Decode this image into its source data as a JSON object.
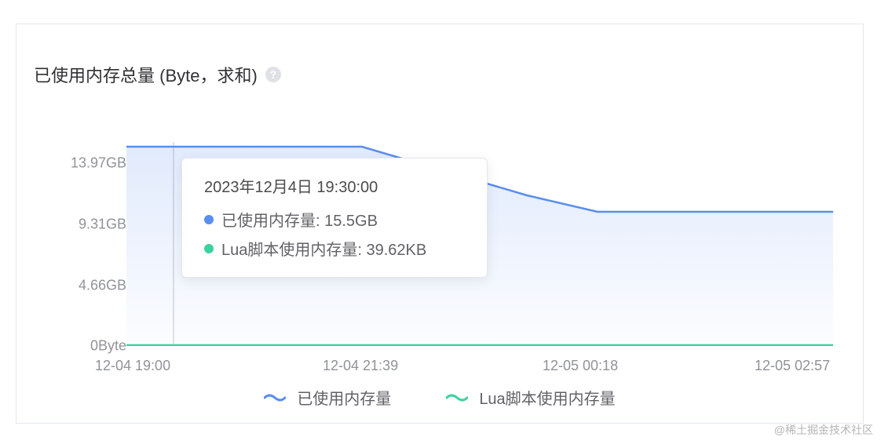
{
  "title": "已使用内存总量 (Byte，求和)",
  "help_icon": "?",
  "y_ticks": [
    "13.97GB",
    "9.31GB",
    "4.66GB",
    "0Byte"
  ],
  "x_ticks": [
    "12-04 19:00",
    "12-04 21:39",
    "12-05 00:18",
    "12-05 02:57"
  ],
  "tooltip": {
    "time": "2023年12月4日 19:30:00",
    "rows": [
      {
        "label": "已使用内存量: 15.5GB",
        "color": "#5a8dee"
      },
      {
        "label": "Lua脚本使用内存量: 39.62KB",
        "color": "#3ad29f"
      }
    ]
  },
  "legend": [
    {
      "label": "已使用内存量",
      "color": "#5a8dee"
    },
    {
      "label": "Lua脚本使用内存量",
      "color": "#3ad29f"
    }
  ],
  "watermark": "@稀土掘金技术社区",
  "chart_data": {
    "type": "area",
    "title": "已使用内存总量 (Byte，求和)",
    "xlabel": "",
    "ylabel": "",
    "ylim": [
      0,
      15.5
    ],
    "x": [
      "12-04 19:00",
      "12-04 19:30",
      "12-04 21:39",
      "12-04 23:30",
      "12-05 00:18",
      "12-05 02:57"
    ],
    "series": [
      {
        "name": "已使用内存量",
        "unit": "GB",
        "values": [
          15.5,
          15.5,
          15.5,
          11.5,
          10.3,
          10.3
        ],
        "color": "#5a8dee"
      },
      {
        "name": "Lua脚本使用内存量",
        "unit": "KB",
        "values": [
          39.62,
          39.62,
          39.62,
          39.62,
          39.62,
          39.62
        ],
        "color": "#3ad29f"
      }
    ],
    "x_tick_labels": [
      "12-04 19:00",
      "12-04 21:39",
      "12-05 00:18",
      "12-05 02:57"
    ],
    "y_tick_labels": [
      "0Byte",
      "4.66GB",
      "9.31GB",
      "13.97GB"
    ]
  }
}
